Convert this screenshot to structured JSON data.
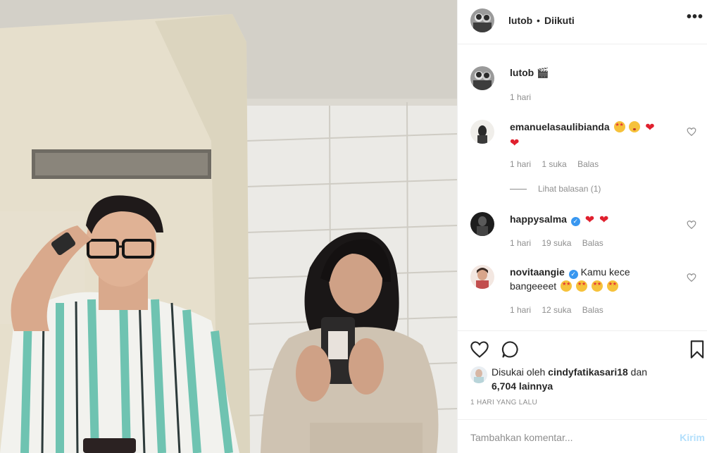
{
  "post": {
    "username": "lutob",
    "separator": "•",
    "follow_status": "Diikuti",
    "more_icon": "more-options-icon"
  },
  "caption": {
    "username": "lutob",
    "emoji": "🎬",
    "time": "1 hari"
  },
  "comments": [
    {
      "username": "emanuelasaulibianda",
      "text": "",
      "time": "1 hari",
      "likes": "1 suka",
      "reply": "Balas",
      "view_replies": "Lihat balasan (1)"
    },
    {
      "username": "happysalma",
      "text": "",
      "time": "1 hari",
      "likes": "19 suka",
      "reply": "Balas"
    },
    {
      "username": "novitaangie",
      "text_line1": "Kamu kece",
      "text_line2": "bangeeeet",
      "time": "1 hari",
      "likes": "12 suka",
      "reply": "Balas"
    }
  ],
  "actions": {
    "liked_prefix": "Disukai oleh",
    "liked_user": "cindyfatikasari18",
    "liked_and": "dan",
    "liked_count": "6,704 lainnya",
    "time_ago": "1 HARI YANG LALU",
    "comment_placeholder": "Tambahkan komentar...",
    "post_label": "Kirim"
  },
  "colors": {
    "accent": "#3897f0",
    "muted": "#8e8e8e",
    "post_disabled": "#b2dffc",
    "heart": "#e0202e"
  }
}
